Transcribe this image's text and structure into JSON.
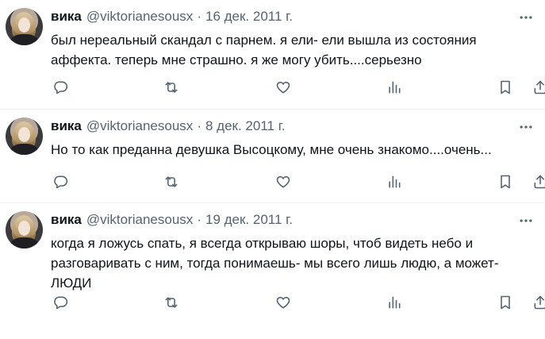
{
  "tweets": [
    {
      "name": "вика",
      "handle": "@viktorianesousx",
      "separator": "·",
      "date": "16 дек. 2011 г.",
      "text": "был нереальный скандал с парнем. я ели- ели вышла из состояния аффекта. теперь мне страшно. я же могу убить....серьезно"
    },
    {
      "name": "вика",
      "handle": "@viktorianesousx",
      "separator": "·",
      "date": "8 дек. 2011 г.",
      "text": "Но то как преданна девушка Высоцкому, мне очень знакомо....очень..."
    },
    {
      "name": "вика",
      "handle": "@viktorianesousx",
      "separator": "·",
      "date": "19 дек. 2011 г.",
      "text": "когда я ложусь спать, я всегда открываю шоры, чтоб видеть небо и разговаривать с ним, тогда понимаешь- мы всего лишь людю, а может- ЛЮДИ"
    }
  ],
  "icons": {
    "more": "more-icon",
    "reply": "reply-icon",
    "retweet": "retweet-icon",
    "like": "like-icon",
    "views": "views-icon",
    "bookmark": "bookmark-icon",
    "share": "share-icon"
  },
  "colors": {
    "text": "#0f1419",
    "secondary": "#536471",
    "divider": "#eff3f4"
  }
}
